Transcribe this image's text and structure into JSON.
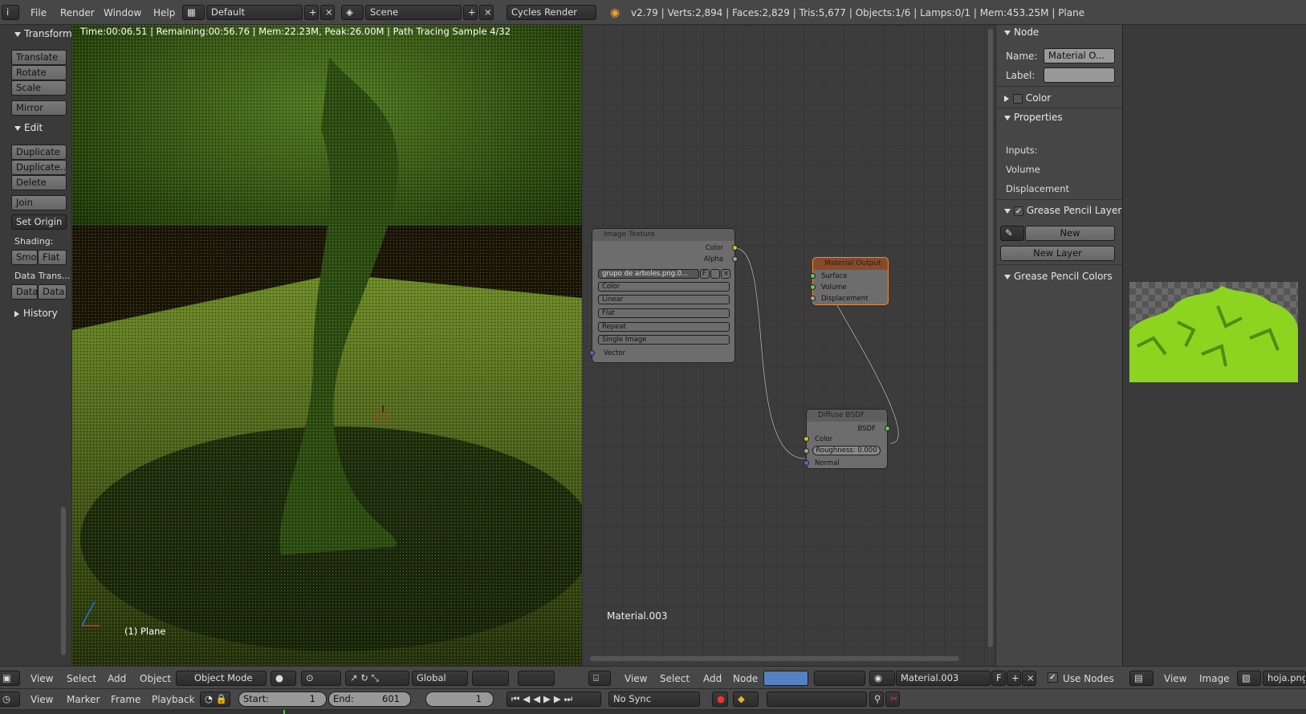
{
  "topbar": {
    "menus": [
      "File",
      "Render",
      "Window",
      "Help"
    ],
    "layout": "Default",
    "scene": "Scene",
    "engine": "Cycles Render",
    "stats": "v2.79 | Verts:2,894 | Faces:2,829 | Tris:5,677 | Objects:1/6 | Lamps:0/1 | Mem:453.25M | Plane"
  },
  "toolshelf": {
    "transform_header": "Transform",
    "translate": "Translate",
    "rotate": "Rotate",
    "scale": "Scale",
    "mirror": "Mirror",
    "edit_header": "Edit",
    "duplicate": "Duplicate",
    "duplicate_linked": "Duplicate...",
    "delete": "Delete",
    "join": "Join",
    "set_origin": "Set Origin",
    "shading_label": "Shading:",
    "smooth": "Smo",
    "flat": "Flat",
    "data_transfer_label": "Data Trans...",
    "data1": "Data",
    "data2": "Data",
    "history_header": "History"
  },
  "viewport": {
    "render_info": "Time:00:06.51 | Remaining:00:56.76 | Mem:22.23M, Peak:26.00M | Path Tracing Sample 4/32",
    "object_label": "(1) Plane",
    "bottom": {
      "view": "View",
      "select": "Select",
      "add": "Add",
      "object": "Object",
      "mode": "Object Mode",
      "orientation": "Global"
    }
  },
  "nodes": {
    "image_texture": {
      "title": "Image Texture",
      "out_color": "Color",
      "out_alpha": "Alpha",
      "file": "grupo de arboles.png.0...",
      "fake": "F",
      "color_space": "Color",
      "interp": "Linear",
      "projection": "Flat",
      "extension": "Repeat",
      "source": "Single Image",
      "in_vector": "Vector"
    },
    "material_output": {
      "title": "Material Output",
      "surface": "Surface",
      "volume": "Volume",
      "displacement": "Displacement"
    },
    "diffuse": {
      "title": "Diffuse BSDF",
      "out_bsdf": "BSDF",
      "in_color": "Color",
      "roughness": "Roughness: 0.000",
      "in_normal": "Normal"
    },
    "material_label": "Material.003",
    "bottom": {
      "view": "View",
      "select": "Select",
      "add": "Add",
      "node": "Node",
      "material": "Material.003",
      "fake": "F",
      "use_nodes": "Use Nodes"
    }
  },
  "props": {
    "node_header": "Node",
    "name_label": "Name:",
    "name_value": "Material O...",
    "label_label": "Label:",
    "color_header": "Color",
    "properties_header": "Properties",
    "inputs": "Inputs:",
    "volume": "Volume",
    "displacement": "Displacement",
    "gp_layer_header": "Grease Pencil Layer",
    "new": "New",
    "new_layer": "New Layer",
    "gp_colors_header": "Grease Pencil Colors"
  },
  "image_editor": {
    "view": "View",
    "image": "Image",
    "image_name": "hoja.png"
  },
  "timeline": {
    "view": "View",
    "marker": "Marker",
    "frame": "Frame",
    "playback": "Playback",
    "start": "Start:",
    "start_val": "1",
    "end": "End:",
    "end_val": "601",
    "current": "1",
    "sync": "No Sync"
  }
}
